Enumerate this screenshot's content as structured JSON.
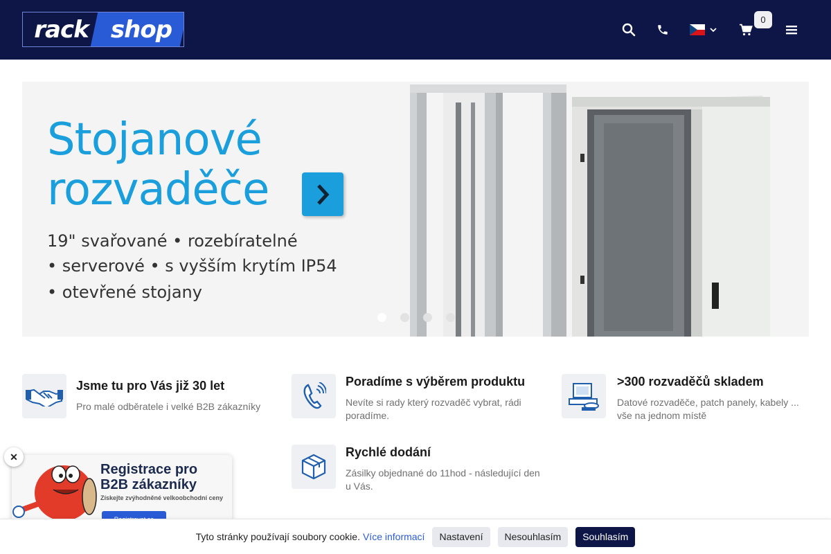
{
  "header": {
    "logo_left": "rack",
    "logo_right": "shop",
    "cart_count": "0",
    "icons": [
      "search-icon",
      "phone-icon",
      "czech-flag-icon",
      "cart-icon",
      "menu-icon"
    ]
  },
  "banner": {
    "title_line1": "Stojanové",
    "title_line2": "rozvaděče",
    "line1": "19\" svařované • rozebíratelné",
    "line2": "• serverové • s vyšším krytím IP54",
    "line3": "• otevřené stojany",
    "slides": 4,
    "active_slide": 1,
    "accent": "#1a9fdc"
  },
  "features": [
    {
      "title": "Jsme tu pro Vás již 30 let",
      "desc": "Pro malé odběratele i velké B2B zákazníky",
      "icon": "handshake-icon"
    },
    {
      "title": "Poradíme s výběrem produktu",
      "desc": "Nevíte si rady který rozvaděč vybrat, rádi poradíme.",
      "icon": "phone-call-icon"
    },
    {
      "title": ">300 rozvaděčů skladem",
      "desc": "Datové rozvaděče, patch panely, kabely ... vše na jednom místě",
      "icon": "stock-icon"
    },
    {
      "title": "Rychlé dodání",
      "desc": "Zásilky objednané do 11hod - následující den u Vás.",
      "icon": "package-icon"
    }
  ],
  "promo": {
    "close": "✕",
    "title": "Registrace pro B2B zákazníky",
    "subtitle": "Získejte zvýhodněné velkoobchodní ceny",
    "button": "Registrovat se"
  },
  "cookie": {
    "text": "Tyto stránky používají soubory cookie.",
    "link": "Více informací",
    "settings": "Nastavení",
    "reject": "Nesouhlasím",
    "accept": "Souhlasím"
  },
  "colors": {
    "navy": "#0d1646",
    "brand_blue": "#2a5bd7"
  }
}
